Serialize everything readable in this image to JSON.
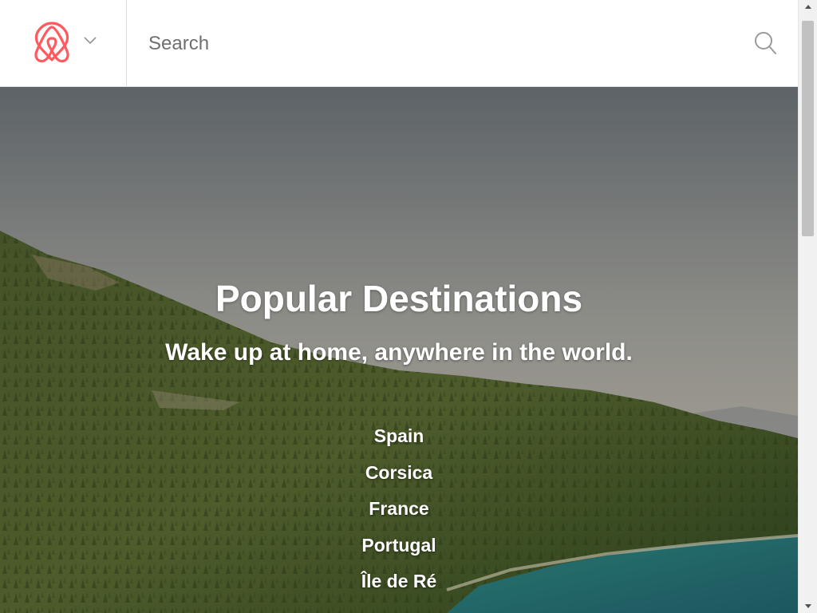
{
  "header": {
    "logo_icon": "airbnb-belo-icon",
    "menu_icon": "chevron-down-icon",
    "search": {
      "placeholder": "Search",
      "value": "",
      "icon": "search-icon"
    }
  },
  "hero": {
    "title": "Popular Destinations",
    "subtitle": "Wake up at home, anywhere in the world.",
    "destinations": [
      "Spain",
      "Corsica",
      "France",
      "Portugal",
      "Île de Ré"
    ]
  },
  "colors": {
    "brand": "#FF5A5F",
    "header_border": "#DCE0E0",
    "search_text": "#6F6F6F",
    "icon_gray": "#9A9A9A"
  }
}
